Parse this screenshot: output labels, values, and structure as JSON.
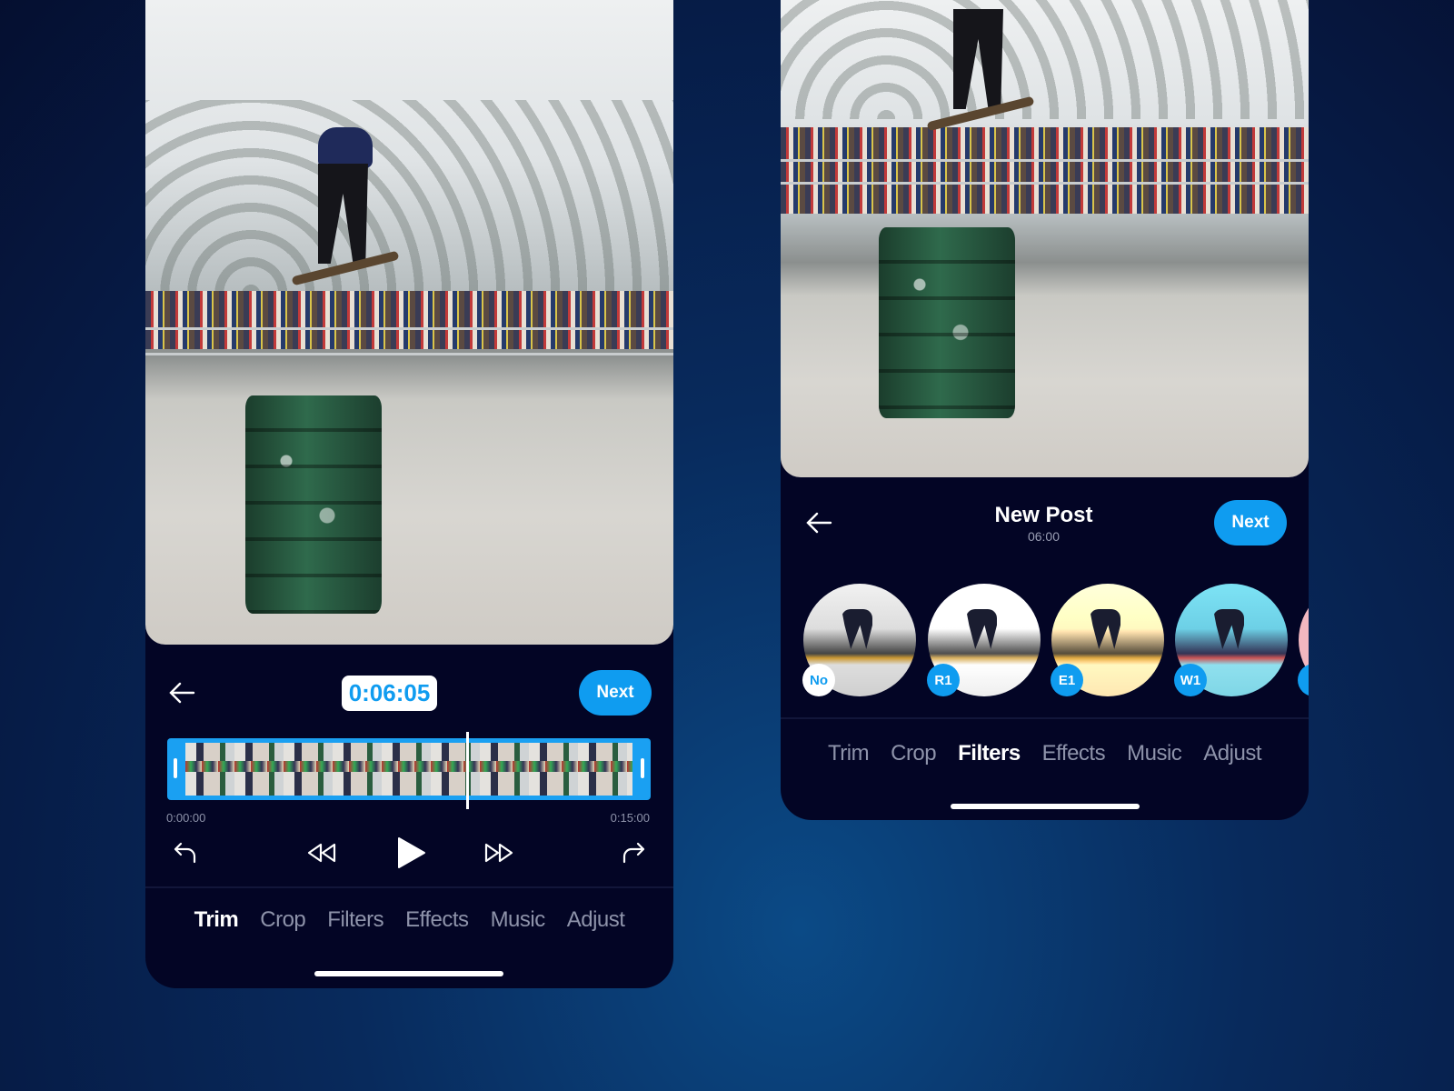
{
  "trim_screen": {
    "timecode": "0:06:05",
    "next_label": "Next",
    "start_time": "0:00:00",
    "end_time": "0:15:00",
    "playhead_position_fraction": 0.62,
    "tabs": [
      {
        "label": "Trim",
        "active": true
      },
      {
        "label": "Crop"
      },
      {
        "label": "Filters"
      },
      {
        "label": "Effects"
      },
      {
        "label": "Music"
      },
      {
        "label": "Adjust"
      }
    ]
  },
  "filters_screen": {
    "title": "New Post",
    "subtitle": "06:00",
    "next_label": "Next",
    "filters": [
      {
        "label": "No",
        "selected": true
      },
      {
        "label": "R1"
      },
      {
        "label": "E1"
      },
      {
        "label": "W1"
      }
    ],
    "tabs": [
      {
        "label": "Trim"
      },
      {
        "label": "Crop"
      },
      {
        "label": "Filters",
        "active": true
      },
      {
        "label": "Effects"
      },
      {
        "label": "Music"
      },
      {
        "label": "Adjust"
      }
    ]
  },
  "colors": {
    "accent": "#0f9cf0",
    "panel": "#030525"
  }
}
